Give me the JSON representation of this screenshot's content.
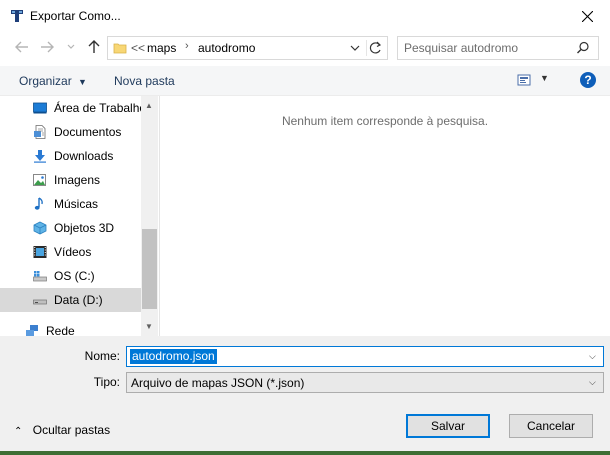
{
  "window": {
    "title": "Exportar Como...",
    "close_icon": "close-icon"
  },
  "address": {
    "overflow": "<<",
    "crumbs": [
      "maps",
      "autodromo"
    ]
  },
  "search": {
    "placeholder": "Pesquisar autodromo"
  },
  "toolbar": {
    "organize_label": "Organizar",
    "new_folder_label": "Nova pasta",
    "help_label": "?"
  },
  "navigation": {
    "items": [
      {
        "label": "Área de Trabalho",
        "icon": "desktop-icon"
      },
      {
        "label": "Documentos",
        "icon": "documents-icon"
      },
      {
        "label": "Downloads",
        "icon": "downloads-icon"
      },
      {
        "label": "Imagens",
        "icon": "pictures-icon"
      },
      {
        "label": "Músicas",
        "icon": "music-icon"
      },
      {
        "label": "Objetos 3D",
        "icon": "objects-3d-icon"
      },
      {
        "label": "Vídeos",
        "icon": "videos-icon"
      },
      {
        "label": "OS (C:)",
        "icon": "drive-c-icon"
      },
      {
        "label": "Data (D:)",
        "icon": "drive-d-icon",
        "selected": true
      },
      {
        "label": "Rede",
        "icon": "network-icon"
      }
    ]
  },
  "content": {
    "empty_message": "Nenhum item corresponde à pesquisa."
  },
  "form": {
    "name_label": "Nome:",
    "name_value": "autodromo.json",
    "type_label": "Tipo:",
    "type_value": "Arquivo de mapas JSON (*.json)"
  },
  "footer": {
    "toggle_label": "Ocultar pastas",
    "save_label": "Salvar",
    "cancel_label": "Cancelar"
  },
  "colors": {
    "accent": "#0078d7",
    "help": "#0e5eb9",
    "link_text": "#1e395b"
  }
}
